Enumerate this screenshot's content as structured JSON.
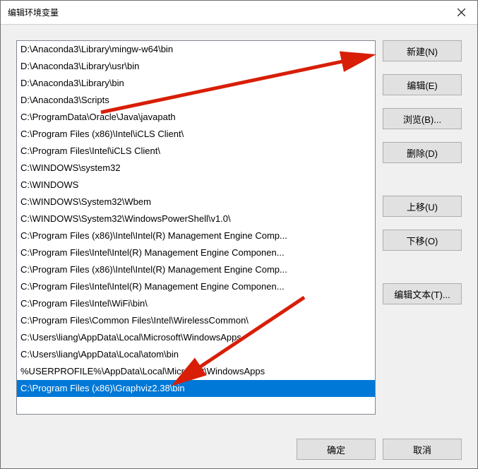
{
  "window": {
    "title": "编辑环境变量"
  },
  "path_list": [
    "D:\\Anaconda3\\Library\\mingw-w64\\bin",
    "D:\\Anaconda3\\Library\\usr\\bin",
    "D:\\Anaconda3\\Library\\bin",
    "D:\\Anaconda3\\Scripts",
    "C:\\ProgramData\\Oracle\\Java\\javapath",
    "C:\\Program Files (x86)\\Intel\\iCLS Client\\",
    "C:\\Program Files\\Intel\\iCLS Client\\",
    "C:\\WINDOWS\\system32",
    "C:\\WINDOWS",
    "C:\\WINDOWS\\System32\\Wbem",
    "C:\\WINDOWS\\System32\\WindowsPowerShell\\v1.0\\",
    "C:\\Program Files (x86)\\Intel\\Intel(R) Management Engine Comp...",
    "C:\\Program Files\\Intel\\Intel(R) Management Engine Componen...",
    "C:\\Program Files (x86)\\Intel\\Intel(R) Management Engine Comp...",
    "C:\\Program Files\\Intel\\Intel(R) Management Engine Componen...",
    "C:\\Program Files\\Intel\\WiFi\\bin\\",
    "C:\\Program Files\\Common Files\\Intel\\WirelessCommon\\",
    "C:\\Users\\liang\\AppData\\Local\\Microsoft\\WindowsApps",
    "C:\\Users\\liang\\AppData\\Local\\atom\\bin",
    "%USERPROFILE%\\AppData\\Local\\Microsoft\\WindowsApps",
    "C:\\Program Files (x86)\\Graphviz2.38\\bin"
  ],
  "selected_index": 20,
  "buttons": {
    "new": "新建(N)",
    "edit": "编辑(E)",
    "browse": "浏览(B)...",
    "delete": "删除(D)",
    "move_up": "上移(U)",
    "move_down": "下移(O)",
    "edit_text": "编辑文本(T)...",
    "ok": "确定",
    "cancel": "取消"
  },
  "annotations": {
    "arrow1_color": "#d81e06",
    "arrow2_color": "#d81e06"
  }
}
